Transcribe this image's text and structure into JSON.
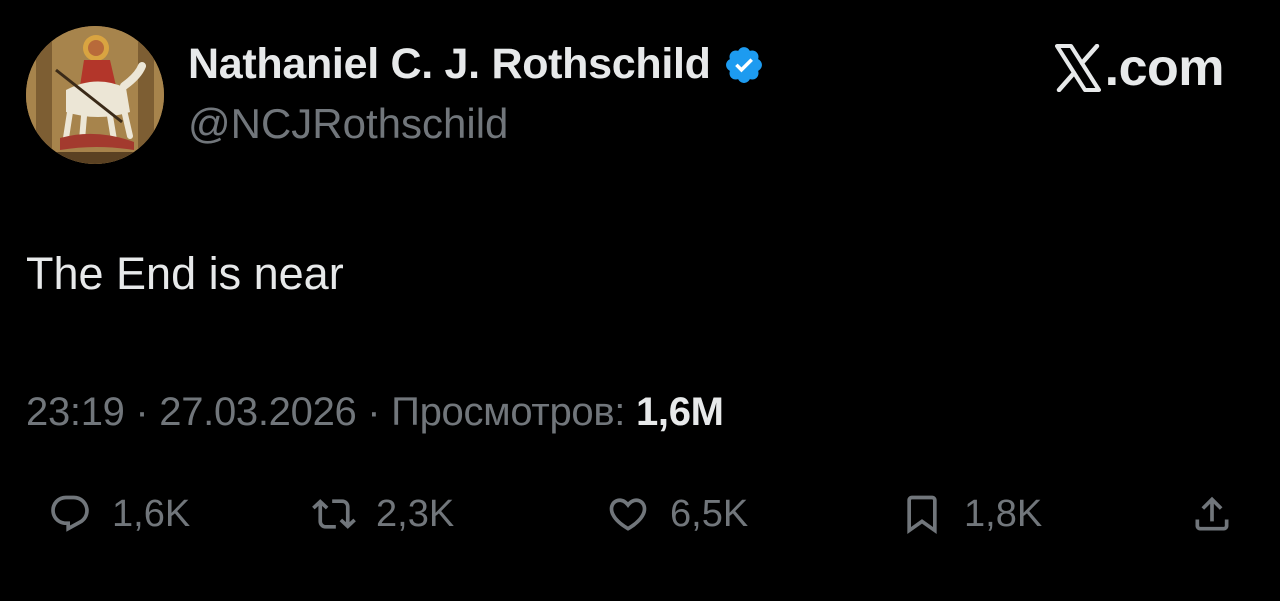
{
  "author": {
    "display_name": "Nathaniel C. J. Rothschild",
    "handle": "@NCJRothschild",
    "verified": true,
    "avatar": "icon-painting-avatar"
  },
  "brand": {
    "mark": "x-logo-icon",
    "label": ".com"
  },
  "tweet": {
    "text": "The End is near"
  },
  "meta": {
    "time": "23:19",
    "separator": " · ",
    "date": "27.03.2026",
    "views_label": "Просмотров:",
    "views_value": "1,6M"
  },
  "actions": {
    "replies": "1,6K",
    "reposts": "2,3K",
    "likes": "6,5K",
    "bookmarks": "1,8K"
  },
  "colors": {
    "background": "#000000",
    "primary_text": "#e7e9ea",
    "secondary_text": "#71767b",
    "verified_badge": "#1d9bf0"
  }
}
